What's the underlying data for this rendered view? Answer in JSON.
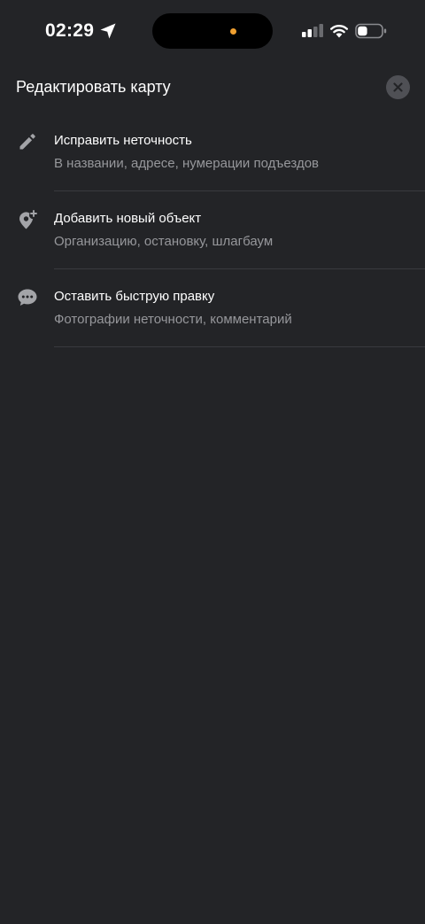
{
  "status_bar": {
    "time": "02:29",
    "location_icon": "location-arrow-icon",
    "privacy_dot_color": "#f0a030",
    "signal_icon": "cellular-signal-icon",
    "wifi_icon": "wifi-icon",
    "battery_icon": "battery-icon",
    "battery_level": 0.25
  },
  "sheet": {
    "title": "Редактировать карту",
    "close_icon": "close-icon",
    "items": [
      {
        "icon": "pencil-icon",
        "title": "Исправить неточность",
        "subtitle": "В названии, адресе, нумерации подъездов"
      },
      {
        "icon": "add-place-pin-icon",
        "title": "Добавить новый объект",
        "subtitle": "Организацию, остановку, шлагбаум"
      },
      {
        "icon": "chat-bubble-icon",
        "title": "Оставить быструю правку",
        "subtitle": "Фотографии неточности, комментарий"
      }
    ]
  },
  "colors": {
    "background": "#232427",
    "icon_gray": "#a3a4a8",
    "subtitle_gray": "#96979b",
    "close_button_bg": "#4f5055"
  }
}
